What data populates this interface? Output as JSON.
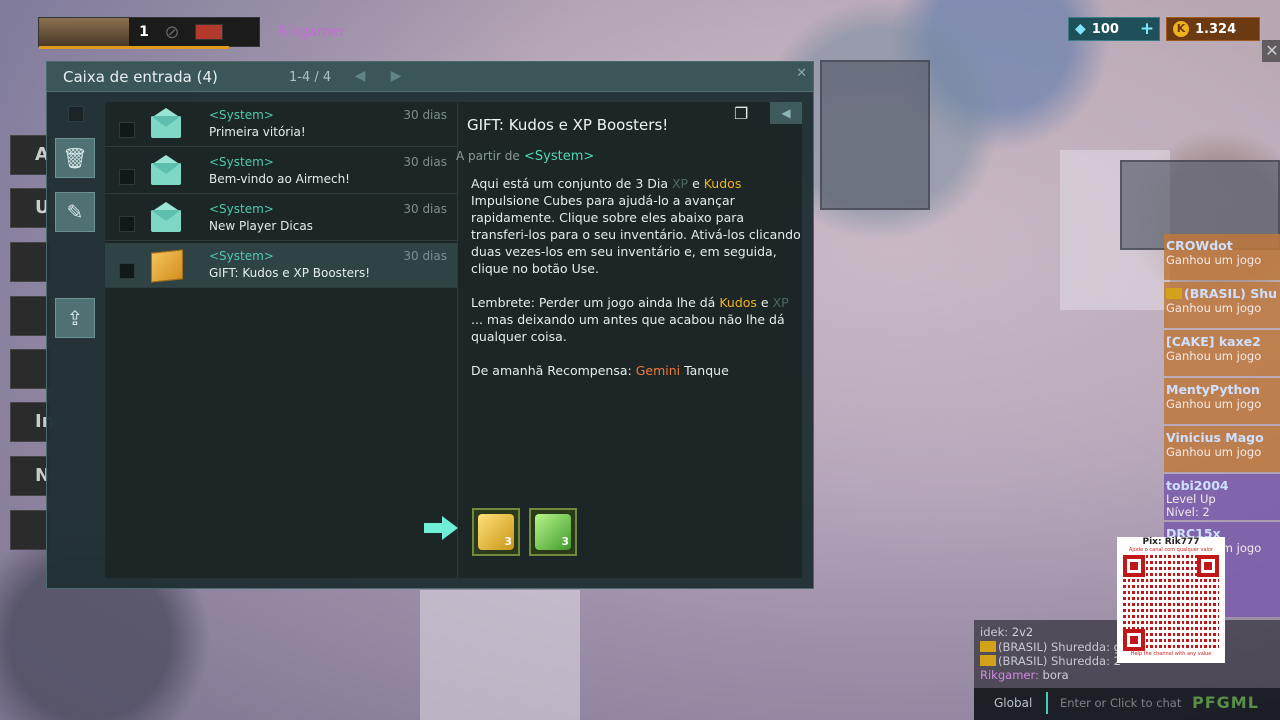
{
  "player": {
    "level": "1",
    "name": "Rikgamer"
  },
  "currency": {
    "gems": "100",
    "gems_plus": "+",
    "kudos": "1.324"
  },
  "close_label": "✕",
  "side_buttons": [
    "A",
    "U",
    "",
    "",
    "",
    "In",
    "N",
    ""
  ],
  "inbox": {
    "title": "Caixa de entrada (4)",
    "pager": "1-4 / 4",
    "mails": [
      {
        "sender": "<System>",
        "subject": "Primeira vitória!",
        "age": "30 dias",
        "icon": "envelope-icon"
      },
      {
        "sender": "<System>",
        "subject": "Bem-vindo ao Airmech!",
        "age": "30 dias",
        "icon": "envelope-icon"
      },
      {
        "sender": "<System>",
        "subject": "New Player Dicas",
        "age": "30 dias",
        "icon": "envelope-icon"
      },
      {
        "sender": "<System>",
        "subject": "GIFT: Kudos e XP Boosters!",
        "age": "30 dias",
        "icon": "gift-box-icon",
        "selected": true
      }
    ],
    "view": {
      "subject": "GIFT: Kudos e XP Boosters!",
      "from_label": "A partir de",
      "from": "<System>",
      "p1_a": "Aqui está um conjunto de 3 Dia ",
      "p1_xp": "XP",
      "p1_e": " e ",
      "p1_kudos": "Kudos",
      "p1_b": " Impulsione Cubes para ajudá-lo a avançar rapidamente. Clique sobre eles abaixo para transferi-los para o seu inventário. Ativá-los clicando duas vezes-los em seu inventário e, em seguida, clique no botão Use.",
      "p2_a": "Lembrete: Perder um jogo ainda lhe dá ",
      "p2_kudos": "Kudos",
      "p2_e": " e ",
      "p2_xp": "XP",
      "p2_b": " ... mas deixando um antes que acabou não lhe dá qualquer coisa.",
      "p3_a": "De amanhã Recompensa: ",
      "p3_gemini": "Gemini",
      "p3_b": " Tanque",
      "attachments": [
        {
          "name": "kudos-booster-cube",
          "badge": "3"
        },
        {
          "name": "xp-booster-cube",
          "badge": "3"
        }
      ]
    }
  },
  "feed": [
    {
      "name": "CROWdot",
      "action": "Ganhou um jogo",
      "style": "orange"
    },
    {
      "name": "(BRASIL) Shu",
      "action": "Ganhou um jogo",
      "style": "orange"
    },
    {
      "name": "[CAKE] kaxe2",
      "action": "Ganhou um jogo",
      "style": "orange"
    },
    {
      "name": "MentyPython",
      "action": "Ganhou um jogo",
      "style": "orange"
    },
    {
      "name": "Vinicius Mago",
      "action": "Ganhou um jogo",
      "style": "orange"
    },
    {
      "name": "tobi2004",
      "action": "Level Up",
      "action2": "Nível: 2",
      "style": "purple"
    },
    {
      "name": "DRC15x",
      "action": "Ganhou um jogo",
      "style": "purple"
    }
  ],
  "qr": {
    "title": "Pix: Rik777",
    "subtitle": "Ajude o canal com qualquer valor",
    "footer": "Help the channel with any value"
  },
  "chat": {
    "lines": [
      {
        "who": "idek:",
        "text": " 2v2"
      },
      {
        "who": "(BRASIL) Shuredda:",
        "text": " g"
      },
      {
        "who": "(BRASIL) Shuredda:",
        "text": " 2"
      },
      {
        "who": "Rikgamer:",
        "text": " bora",
        "me": true
      }
    ],
    "channel": "Global",
    "placeholder": "Enter or Click to chat",
    "watermark": "PFGML"
  },
  "colors": {
    "accent": "#4fd8b5",
    "kudos": "#f0b21c",
    "gemini": "#f07a3a",
    "panel": "#1c2627"
  }
}
